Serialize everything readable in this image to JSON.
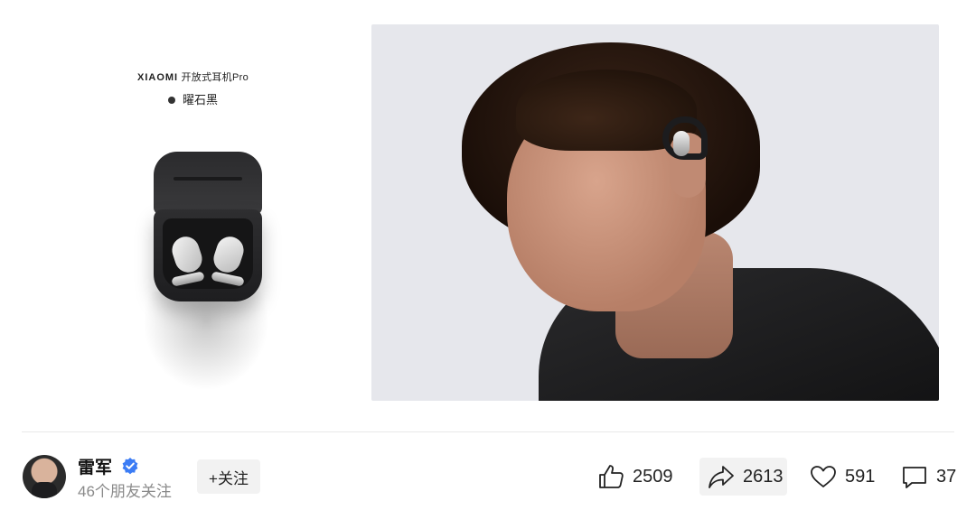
{
  "product": {
    "brand_logo": "XIAOMI",
    "product_name": "开放式耳机Pro",
    "color_name": "曜石黑"
  },
  "author": {
    "name": "雷军",
    "verified": true,
    "friends_following": "46个朋友关注",
    "follow_label": "+关注"
  },
  "stats": {
    "likes": "2509",
    "shares": "2613",
    "favorites": "591",
    "comments": "37"
  },
  "colors": {
    "verified_badge": "#3b7cf5",
    "hero_background": "#e6e7ec",
    "button_background": "#f2f2f2",
    "muted_text": "#8a8a8a"
  }
}
